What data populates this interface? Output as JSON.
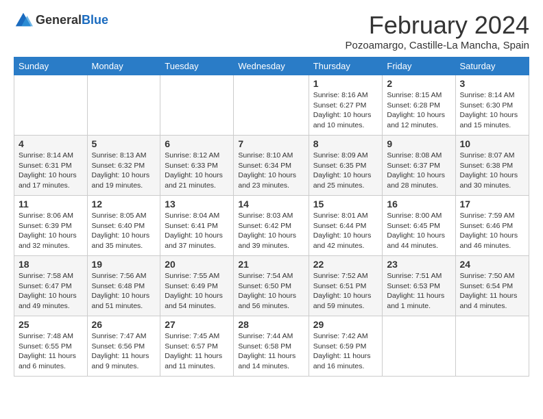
{
  "header": {
    "logo_general": "General",
    "logo_blue": "Blue",
    "month_title": "February 2024",
    "location": "Pozoamargo, Castille-La Mancha, Spain"
  },
  "weekdays": [
    "Sunday",
    "Monday",
    "Tuesday",
    "Wednesday",
    "Thursday",
    "Friday",
    "Saturday"
  ],
  "weeks": [
    [
      {
        "day": "",
        "info": ""
      },
      {
        "day": "",
        "info": ""
      },
      {
        "day": "",
        "info": ""
      },
      {
        "day": "",
        "info": ""
      },
      {
        "day": "1",
        "info": "Sunrise: 8:16 AM\nSunset: 6:27 PM\nDaylight: 10 hours and 10 minutes."
      },
      {
        "day": "2",
        "info": "Sunrise: 8:15 AM\nSunset: 6:28 PM\nDaylight: 10 hours and 12 minutes."
      },
      {
        "day": "3",
        "info": "Sunrise: 8:14 AM\nSunset: 6:30 PM\nDaylight: 10 hours and 15 minutes."
      }
    ],
    [
      {
        "day": "4",
        "info": "Sunrise: 8:14 AM\nSunset: 6:31 PM\nDaylight: 10 hours and 17 minutes."
      },
      {
        "day": "5",
        "info": "Sunrise: 8:13 AM\nSunset: 6:32 PM\nDaylight: 10 hours and 19 minutes."
      },
      {
        "day": "6",
        "info": "Sunrise: 8:12 AM\nSunset: 6:33 PM\nDaylight: 10 hours and 21 minutes."
      },
      {
        "day": "7",
        "info": "Sunrise: 8:10 AM\nSunset: 6:34 PM\nDaylight: 10 hours and 23 minutes."
      },
      {
        "day": "8",
        "info": "Sunrise: 8:09 AM\nSunset: 6:35 PM\nDaylight: 10 hours and 25 minutes."
      },
      {
        "day": "9",
        "info": "Sunrise: 8:08 AM\nSunset: 6:37 PM\nDaylight: 10 hours and 28 minutes."
      },
      {
        "day": "10",
        "info": "Sunrise: 8:07 AM\nSunset: 6:38 PM\nDaylight: 10 hours and 30 minutes."
      }
    ],
    [
      {
        "day": "11",
        "info": "Sunrise: 8:06 AM\nSunset: 6:39 PM\nDaylight: 10 hours and 32 minutes."
      },
      {
        "day": "12",
        "info": "Sunrise: 8:05 AM\nSunset: 6:40 PM\nDaylight: 10 hours and 35 minutes."
      },
      {
        "day": "13",
        "info": "Sunrise: 8:04 AM\nSunset: 6:41 PM\nDaylight: 10 hours and 37 minutes."
      },
      {
        "day": "14",
        "info": "Sunrise: 8:03 AM\nSunset: 6:42 PM\nDaylight: 10 hours and 39 minutes."
      },
      {
        "day": "15",
        "info": "Sunrise: 8:01 AM\nSunset: 6:44 PM\nDaylight: 10 hours and 42 minutes."
      },
      {
        "day": "16",
        "info": "Sunrise: 8:00 AM\nSunset: 6:45 PM\nDaylight: 10 hours and 44 minutes."
      },
      {
        "day": "17",
        "info": "Sunrise: 7:59 AM\nSunset: 6:46 PM\nDaylight: 10 hours and 46 minutes."
      }
    ],
    [
      {
        "day": "18",
        "info": "Sunrise: 7:58 AM\nSunset: 6:47 PM\nDaylight: 10 hours and 49 minutes."
      },
      {
        "day": "19",
        "info": "Sunrise: 7:56 AM\nSunset: 6:48 PM\nDaylight: 10 hours and 51 minutes."
      },
      {
        "day": "20",
        "info": "Sunrise: 7:55 AM\nSunset: 6:49 PM\nDaylight: 10 hours and 54 minutes."
      },
      {
        "day": "21",
        "info": "Sunrise: 7:54 AM\nSunset: 6:50 PM\nDaylight: 10 hours and 56 minutes."
      },
      {
        "day": "22",
        "info": "Sunrise: 7:52 AM\nSunset: 6:51 PM\nDaylight: 10 hours and 59 minutes."
      },
      {
        "day": "23",
        "info": "Sunrise: 7:51 AM\nSunset: 6:53 PM\nDaylight: 11 hours and 1 minute."
      },
      {
        "day": "24",
        "info": "Sunrise: 7:50 AM\nSunset: 6:54 PM\nDaylight: 11 hours and 4 minutes."
      }
    ],
    [
      {
        "day": "25",
        "info": "Sunrise: 7:48 AM\nSunset: 6:55 PM\nDaylight: 11 hours and 6 minutes."
      },
      {
        "day": "26",
        "info": "Sunrise: 7:47 AM\nSunset: 6:56 PM\nDaylight: 11 hours and 9 minutes."
      },
      {
        "day": "27",
        "info": "Sunrise: 7:45 AM\nSunset: 6:57 PM\nDaylight: 11 hours and 11 minutes."
      },
      {
        "day": "28",
        "info": "Sunrise: 7:44 AM\nSunset: 6:58 PM\nDaylight: 11 hours and 14 minutes."
      },
      {
        "day": "29",
        "info": "Sunrise: 7:42 AM\nSunset: 6:59 PM\nDaylight: 11 hours and 16 minutes."
      },
      {
        "day": "",
        "info": ""
      },
      {
        "day": "",
        "info": ""
      }
    ]
  ]
}
